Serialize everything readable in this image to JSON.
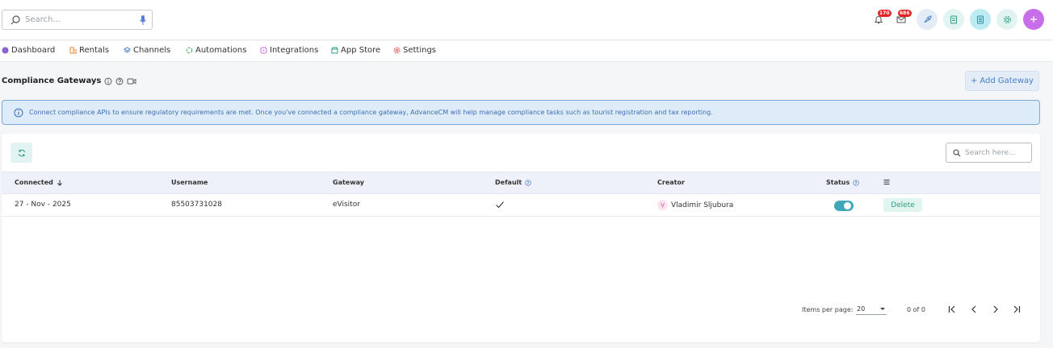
{
  "topbar": {
    "search_placeholder": "Search...",
    "notifications_count": "170",
    "messages_count": "686"
  },
  "nav": {
    "items": [
      {
        "label": "Dashboard",
        "icon": "dashboard-icon"
      },
      {
        "label": "Rentals",
        "icon": "rentals-icon"
      },
      {
        "label": "Channels",
        "icon": "channels-icon"
      },
      {
        "label": "Automations",
        "icon": "automations-icon"
      },
      {
        "label": "Integrations",
        "icon": "integrations-icon"
      },
      {
        "label": "App Store",
        "icon": "app-store-icon"
      },
      {
        "label": "Settings",
        "icon": "settings-icon"
      }
    ]
  },
  "page": {
    "title": "Compliance Gateways",
    "add_button": "Add Gateway",
    "info_text": "Connect compliance APIs to ensure regulatory requirements are met. Once you've connected a compliance gateway, AdvanceCM will help manage compliance tasks such as tourist registration and tax reporting."
  },
  "table": {
    "search_placeholder": "Search here...",
    "columns": [
      "Connected",
      "Username",
      "Gateway",
      "Default",
      "Creator",
      "Status"
    ],
    "rows": [
      {
        "connected": "27 - Nov - 2025",
        "username": "85503731028",
        "gateway": "eVisitor",
        "default": true,
        "creator_initial": "V",
        "creator": "Vladimir Sljubura",
        "status": true,
        "action": "Delete"
      }
    ]
  },
  "pagination": {
    "items_per_page_label": "Items per page:",
    "items_per_page": "20",
    "range": "0 of 0"
  },
  "colors": {
    "accent_teal": "#3fa8b8",
    "info_blue": "#3c6fb0",
    "add_button_bg": "#e3ecf7",
    "plus_button": "#c86ee8"
  }
}
